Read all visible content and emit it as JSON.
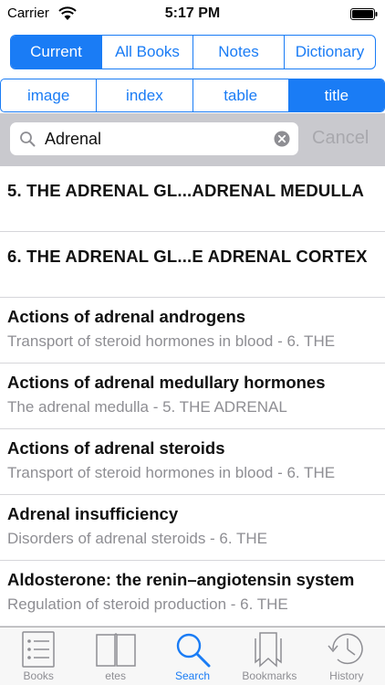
{
  "status_bar": {
    "carrier": "Carrier",
    "time": "5:17 PM"
  },
  "scope_tabs": [
    {
      "label": "Current",
      "active": true
    },
    {
      "label": "All Books",
      "active": false
    },
    {
      "label": "Notes",
      "active": false
    },
    {
      "label": "Dictionary",
      "active": false
    }
  ],
  "field_tabs": [
    {
      "label": "image",
      "active": false
    },
    {
      "label": "index",
      "active": false
    },
    {
      "label": "table",
      "active": false
    },
    {
      "label": "title",
      "active": true
    }
  ],
  "search": {
    "value": "Adrenal",
    "cancel_label": "Cancel"
  },
  "results": [
    {
      "title": "5. THE ADRENAL GL...ADRENAL MEDULLA",
      "subtitle": ""
    },
    {
      "title": "6. THE ADRENAL GL...E ADRENAL CORTEX",
      "subtitle": ""
    },
    {
      "title": "Actions of adrenal androgens",
      "subtitle": "Transport of steroid hormones in blood - 6. THE"
    },
    {
      "title": "Actions of adrenal medullary hormones",
      "subtitle": "The adrenal medulla - 5. THE ADRENAL"
    },
    {
      "title": "Actions of adrenal steroids",
      "subtitle": "Transport of steroid hormones in blood - 6. THE"
    },
    {
      "title": "Adrenal insufficiency",
      "subtitle": "Disorders of adrenal steroids - 6. THE"
    },
    {
      "title": "Aldosterone: the renin–angiotensin system",
      "subtitle": "Regulation of steroid production - 6. THE"
    }
  ],
  "tab_bar": [
    {
      "label": "Books",
      "icon": "books-list-icon",
      "active": false
    },
    {
      "label": "etes",
      "icon": "open-book-icon",
      "active": false
    },
    {
      "label": "Search",
      "icon": "search-icon",
      "active": true
    },
    {
      "label": "Bookmarks",
      "icon": "bookmarks-icon",
      "active": false
    },
    {
      "label": "History",
      "icon": "history-clock-icon",
      "active": false
    }
  ],
  "colors": {
    "accent": "#1a7cf5",
    "secondary_text": "#8e8e93",
    "search_bar_bg": "#c9c9ce"
  }
}
